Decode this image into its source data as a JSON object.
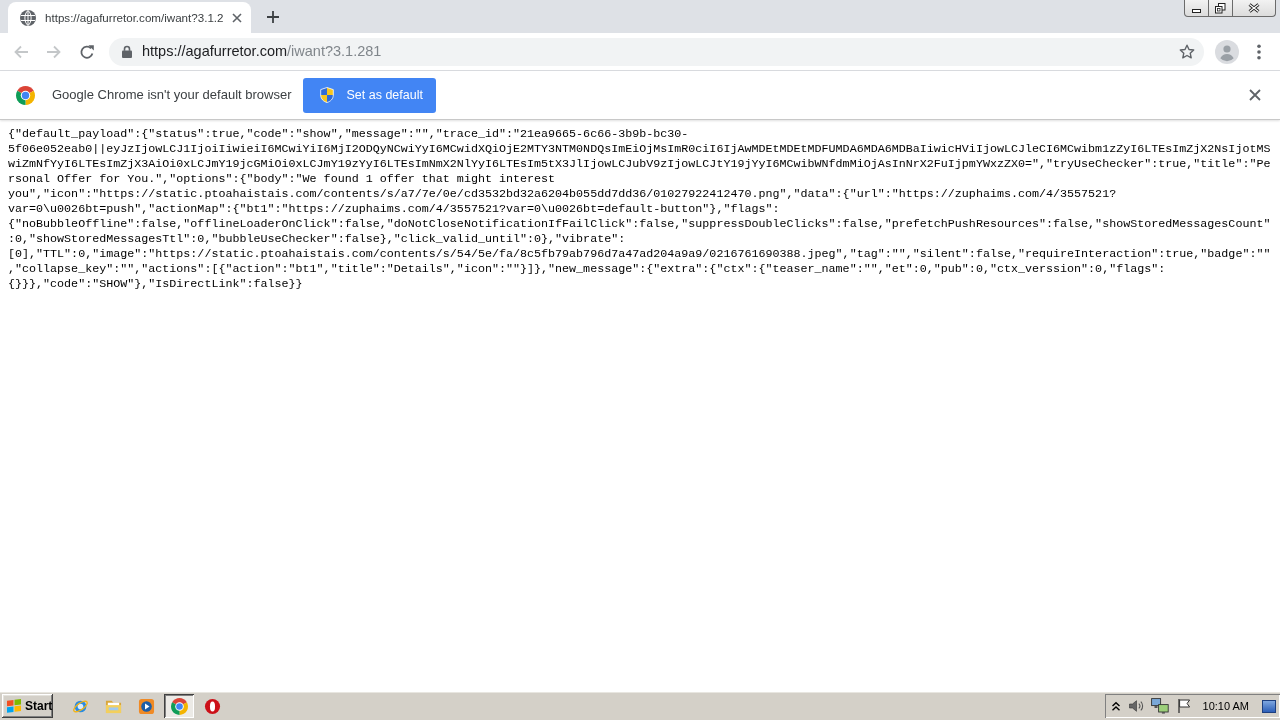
{
  "tabs": [
    {
      "title": "https://agafurretor.com/iwant?3.1.2",
      "selected": true
    }
  ],
  "toolbar": {
    "nav_buttons": [
      {
        "kind": "back",
        "disabled": true
      },
      {
        "kind": "forward",
        "disabled": true
      },
      {
        "kind": "reload",
        "disabled": false
      }
    ],
    "url": {
      "host": "https://agafurretor.com",
      "path": "/iwant?3.1.281"
    }
  },
  "infobar": {
    "message": "Google Chrome isn't your default browser",
    "button": "Set as default"
  },
  "page": {
    "text": "{\"default_payload\":{\"status\":true,\"code\":\"show\",\"message\":\"\",\"trace_id\":\"21ea9665-6c66-3b9b-bc30-5f06e052eab0||eyJzIjowLCJ1IjoiIiwieiI6MCwiYiI6MjI2ODQyNCwiYyI6MCwidXQiOjE2MTY3NTM0NDQsImEiOjMsImR0ciI6IjAwMDEtMDEtMDFUMDA6MDA6MDBaIiwicHViIjowLCJleCI6MCwibm1zZyI6LTEsImZjX2NsIjotMSwiZmNfYyI6LTEsImZjX3AiOi0xLCJmY19jcGMiOi0xLCJmY19zYyI6LTEsImNmX2NlYyI6LTEsIm5tX3JlIjowLCJubV9zIjowLCJtY19jYyI6MCwibWNfdmMiOjAsInNrX2FuIjpmYWxzZX0=\",\"tryUseChecker\":true,\"title\":\"Personal Offer for You.\",\"options\":{\"body\":\"We found 1 offer that might interest you\",\"icon\":\"https://static.ptoahaistais.com/contents/s/a7/7e/0e/cd3532bd32a6204b055dd7dd36/01027922412470.png\",\"data\":{\"url\":\"https://zuphaims.com/4/3557521?var=0\\u0026bt=push\",\"actionMap\":{\"bt1\":\"https://zuphaims.com/4/3557521?var=0\\u0026bt=default-button\"},\"flags\":{\"noBubbleOffline\":false,\"offlineLoaderOnClick\":false,\"doNotCloseNotificationIfFailClick\":false,\"suppressDoubleClicks\":false,\"prefetchPushResources\":false,\"showStoredMessagesCount\":0,\"showStoredMessagesTtl\":0,\"bubbleUseChecker\":false},\"click_valid_until\":0},\"vibrate\":[0],\"TTL\":0,\"image\":\"https://static.ptoahaistais.com/contents/s/54/5e/fa/8c5fb79ab796d7a47ad204a9a9/0216761690388.jpeg\",\"tag\":\"\",\"silent\":false,\"requireInteraction\":true,\"badge\":\"\",\"collapse_key\":\"\",\"actions\":[{\"action\":\"bt1\",\"title\":\"Details\",\"icon\":\"\"}]},\"new_message\":{\"extra\":{\"ctx\":{\"teaser_name\":\"\",\"et\":0,\"pub\":0,\"ctx_verssion\":0,\"flags\":{}}},\"code\":\"SHOW\"},\"IsDirectLink\":false}}"
  },
  "taskbar": {
    "start": "Start",
    "apps": [
      {
        "kind": "ie",
        "selected": false
      },
      {
        "kind": "folder",
        "selected": false
      },
      {
        "kind": "media",
        "selected": false
      },
      {
        "kind": "chrome",
        "selected": true
      },
      {
        "kind": "opera",
        "selected": false
      }
    ],
    "clock": "10:10 AM"
  }
}
